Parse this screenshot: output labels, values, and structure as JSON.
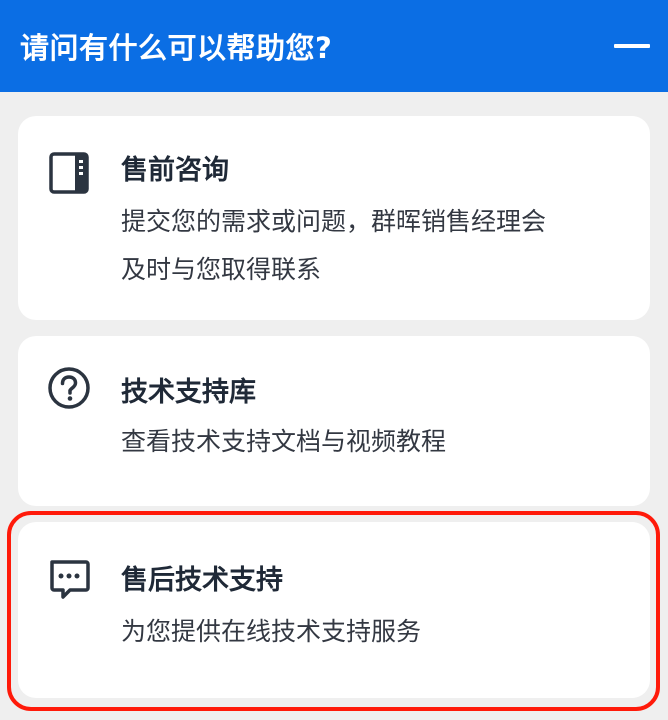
{
  "header": {
    "title": "请问有什么可以帮助您?"
  },
  "cards": [
    {
      "icon": "sidebar-panel-icon",
      "title": "售前咨询",
      "description_lines": [
        "提交您的需求或问题，群晖销售经理会",
        "及时与您取得联系"
      ]
    },
    {
      "icon": "question-circle-icon",
      "title": "技术支持库",
      "description_lines": [
        "查看技术支持文档与视频教程"
      ]
    },
    {
      "icon": "chat-bubble-icon",
      "title": "售后技术支持",
      "description_lines": [
        "为您提供在线技术支持服务"
      ]
    }
  ],
  "colors": {
    "header_bg": "#0b6ee4",
    "page_bg": "#efefef",
    "card_bg": "#ffffff",
    "highlight_border": "#ff1a0a",
    "text_primary": "#1f2937",
    "icon_color": "#2b3440"
  }
}
